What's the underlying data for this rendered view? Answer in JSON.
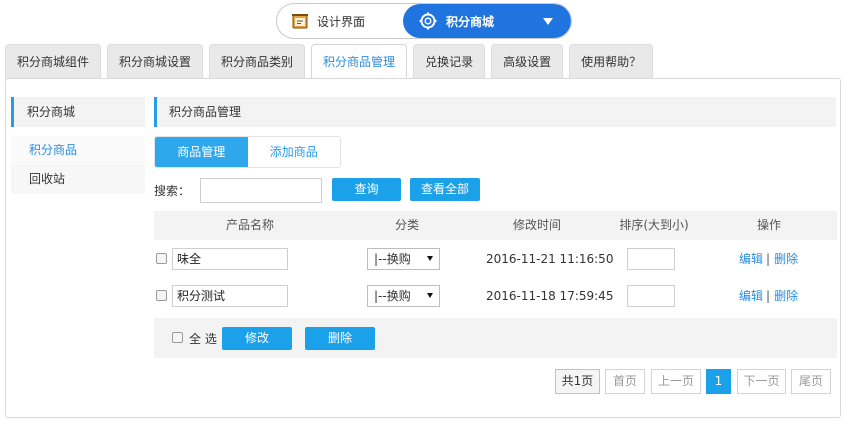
{
  "mode_switch": {
    "design_label": "设计界面",
    "shop_label": "积分商城"
  },
  "tabs": [
    {
      "label": "积分商城组件"
    },
    {
      "label": "积分商城设置"
    },
    {
      "label": "积分商品类别"
    },
    {
      "label": "积分商品管理"
    },
    {
      "label": "兑换记录"
    },
    {
      "label": "高级设置"
    },
    {
      "label": "使用帮助？"
    }
  ],
  "sidebar": {
    "title": "积分商城",
    "items": [
      {
        "label": "积分商品"
      },
      {
        "label": "回收站"
      }
    ]
  },
  "main": {
    "title": "积分商品管理",
    "subtabs": [
      {
        "label": "商品管理"
      },
      {
        "label": "添加商品"
      }
    ]
  },
  "search": {
    "label": "搜索：",
    "value": "",
    "query_button": "查询",
    "view_all_button": "查看全部"
  },
  "table": {
    "headers": [
      "产品名称",
      "分类",
      "修改时间",
      "排序(大到小)",
      "操作"
    ],
    "rows": [
      {
        "name": "味全",
        "category": "|--换购",
        "modified": "2016-11-21 11:16:50",
        "sort": "",
        "edit": "编辑",
        "delete": "删除"
      },
      {
        "name": "积分测试",
        "category": "|--换购",
        "modified": "2016-11-18 17:59:45",
        "sort": "",
        "edit": "编辑",
        "delete": "删除"
      }
    ],
    "separator": "|"
  },
  "bulk": {
    "select_all": "全 选",
    "modify_button": "修改",
    "delete_button": "删除"
  },
  "pagination": {
    "total": "共1页",
    "first": "首页",
    "prev": "上一页",
    "current": "1",
    "next": "下一页",
    "last": "尾页"
  },
  "colors": {
    "accent": "#1aa1ea",
    "switch_active": "#1f74e0",
    "link": "#2b8ce0"
  }
}
